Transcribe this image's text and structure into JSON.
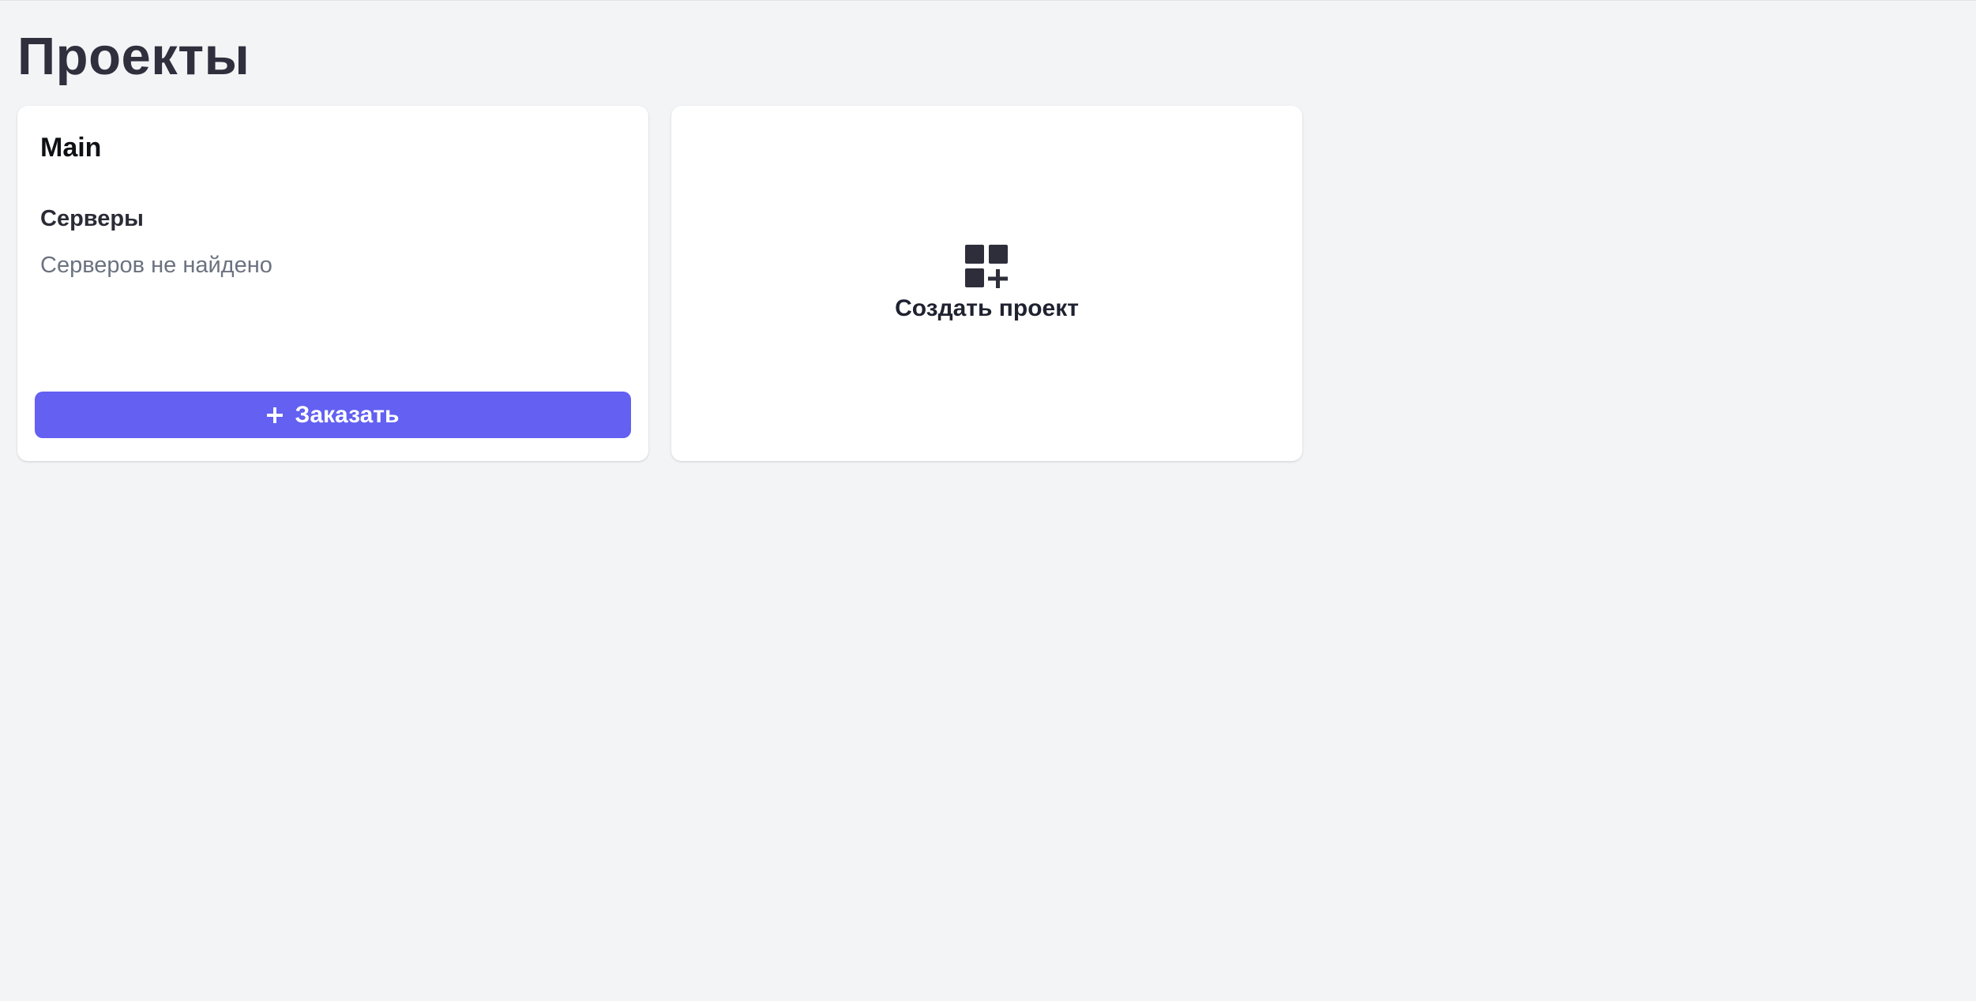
{
  "page": {
    "title": "Проекты"
  },
  "projects": [
    {
      "name": "Main",
      "servers_heading": "Серверы",
      "servers_empty": "Серверов не найдено",
      "order_label": "Заказать",
      "order_icon": "plus-icon"
    }
  ],
  "create_project": {
    "label": "Создать проект",
    "icon": "grid-plus-icon"
  },
  "colors": {
    "background": "#f3f4f6",
    "card": "#ffffff",
    "accent": "#6360f2",
    "title": "#2f2f3d",
    "muted": "#6b7280"
  }
}
